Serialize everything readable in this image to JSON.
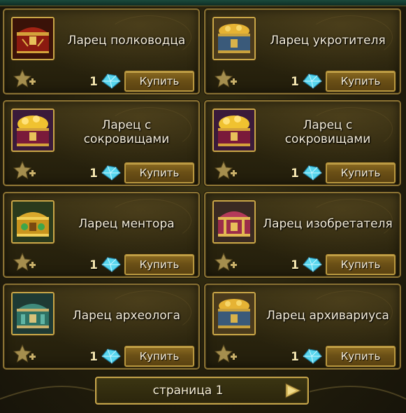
{
  "buy_label": "Купить",
  "items": [
    {
      "name": "Ларец полководца",
      "qty": "1",
      "icon": "red-gold-chest-icon"
    },
    {
      "name": "Ларец укротителя",
      "qty": "1",
      "icon": "blue-gold-treasure-chest-icon"
    },
    {
      "name": "Ларец с сокровищами",
      "qty": "1",
      "icon": "purple-gold-treasure-chest-icon"
    },
    {
      "name": "Ларец с сокровищами",
      "qty": "1",
      "icon": "purple-gold-treasure-chest-icon"
    },
    {
      "name": "Ларец ментора",
      "qty": "1",
      "icon": "gold-green-chest-icon"
    },
    {
      "name": "Ларец изобретателя",
      "qty": "1",
      "icon": "pink-gold-chest-icon"
    },
    {
      "name": "Ларец археолога",
      "qty": "1",
      "icon": "teal-chest-icon"
    },
    {
      "name": "Ларец архивариуса",
      "qty": "1",
      "icon": "blue-gold-treasure-chest-icon"
    }
  ],
  "pager": {
    "label": "страница 1"
  },
  "colors": {
    "gold_border": "#c6a54a",
    "button": "#6b5016",
    "gem": "#58d6ee",
    "text": "#f4ecd8"
  }
}
